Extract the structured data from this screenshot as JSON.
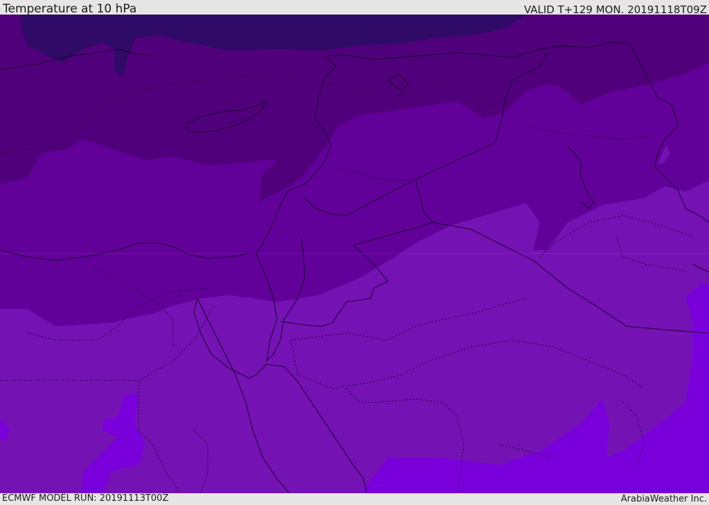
{
  "header": {
    "title": "Temperature at 10 hPa",
    "valid": "VALID T+129 MON. 20191118T09Z"
  },
  "footer": {
    "model_run": "ECMWF MODEL RUN: 20191113T00Z",
    "credit": "ArabiaWeather Inc."
  },
  "map": {
    "colors": {
      "darkest": "#2f0a66",
      "dark": "#51007b",
      "mid": "#62009a",
      "light": "#7512b4",
      "brightest": "#7a00db",
      "borders": "#1a0030"
    }
  }
}
